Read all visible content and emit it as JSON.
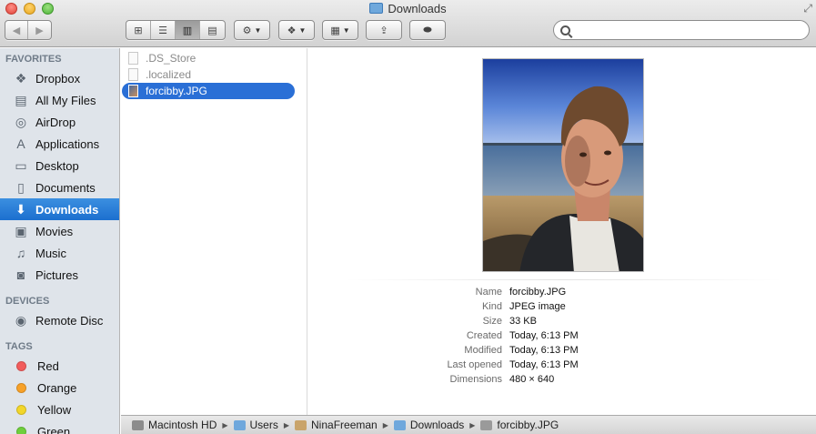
{
  "window": {
    "title": "Downloads"
  },
  "toolbar": {
    "back_label": "◀",
    "forward_label": "▶",
    "view_buttons": [
      "⊞",
      "☰",
      "▥",
      "▤"
    ],
    "action_label": "⚙",
    "dropbox_label": "❖",
    "arrange_label": "▦",
    "share_label": "⇪",
    "tags_label": "⬬"
  },
  "search": {
    "placeholder": "",
    "value": ""
  },
  "sidebar": {
    "favorites_header": "FAVORITES",
    "favorites": [
      {
        "label": "Dropbox",
        "icon": "dropbox-icon",
        "glyph": "❖"
      },
      {
        "label": "All My Files",
        "icon": "all-files-icon",
        "glyph": "▤"
      },
      {
        "label": "AirDrop",
        "icon": "airdrop-icon",
        "glyph": "◎"
      },
      {
        "label": "Applications",
        "icon": "applications-icon",
        "glyph": "A"
      },
      {
        "label": "Desktop",
        "icon": "desktop-icon",
        "glyph": "▭"
      },
      {
        "label": "Documents",
        "icon": "documents-icon",
        "glyph": "▯"
      },
      {
        "label": "Downloads",
        "icon": "downloads-icon",
        "glyph": "⬇",
        "active": true
      },
      {
        "label": "Movies",
        "icon": "movies-icon",
        "glyph": "▣"
      },
      {
        "label": "Music",
        "icon": "music-icon",
        "glyph": "♫"
      },
      {
        "label": "Pictures",
        "icon": "pictures-icon",
        "glyph": "◙"
      }
    ],
    "devices_header": "DEVICES",
    "devices": [
      {
        "label": "Remote Disc",
        "icon": "disc-icon",
        "glyph": "◉"
      }
    ],
    "tags_header": "TAGS",
    "tags": [
      {
        "label": "Red",
        "color": "#f25c5c"
      },
      {
        "label": "Orange",
        "color": "#f7a128"
      },
      {
        "label": "Yellow",
        "color": "#f2d62a"
      },
      {
        "label": "Green",
        "color": "#6fcf3c"
      }
    ]
  },
  "files": [
    {
      "name": ".DS_Store",
      "dim": true
    },
    {
      "name": ".localized",
      "dim": true
    },
    {
      "name": "forcibby.JPG",
      "selected": true,
      "image": true
    }
  ],
  "preview": {
    "info": [
      {
        "key": "Name",
        "value": "forcibby.JPG"
      },
      {
        "key": "Kind",
        "value": "JPEG image"
      },
      {
        "key": "Size",
        "value": "33 KB"
      },
      {
        "key": "Created",
        "value": "Today, 6:13 PM"
      },
      {
        "key": "Modified",
        "value": "Today, 6:13 PM"
      },
      {
        "key": "Last opened",
        "value": "Today, 6:13 PM"
      },
      {
        "key": "Dimensions",
        "value": "480 × 640"
      }
    ]
  },
  "pathbar": [
    {
      "label": "Macintosh HD",
      "icon": "hard-drive-icon",
      "color": "#8c8c8c"
    },
    {
      "label": "Users",
      "icon": "folder-icon",
      "color": "#6fa8dc"
    },
    {
      "label": "NinaFreeman",
      "icon": "home-icon",
      "color": "#c9a46a"
    },
    {
      "label": "Downloads",
      "icon": "downloads-folder-icon",
      "color": "#6fa8dc"
    },
    {
      "label": "forcibby.JPG",
      "icon": "image-file-icon",
      "color": "#9a9a9a"
    }
  ]
}
